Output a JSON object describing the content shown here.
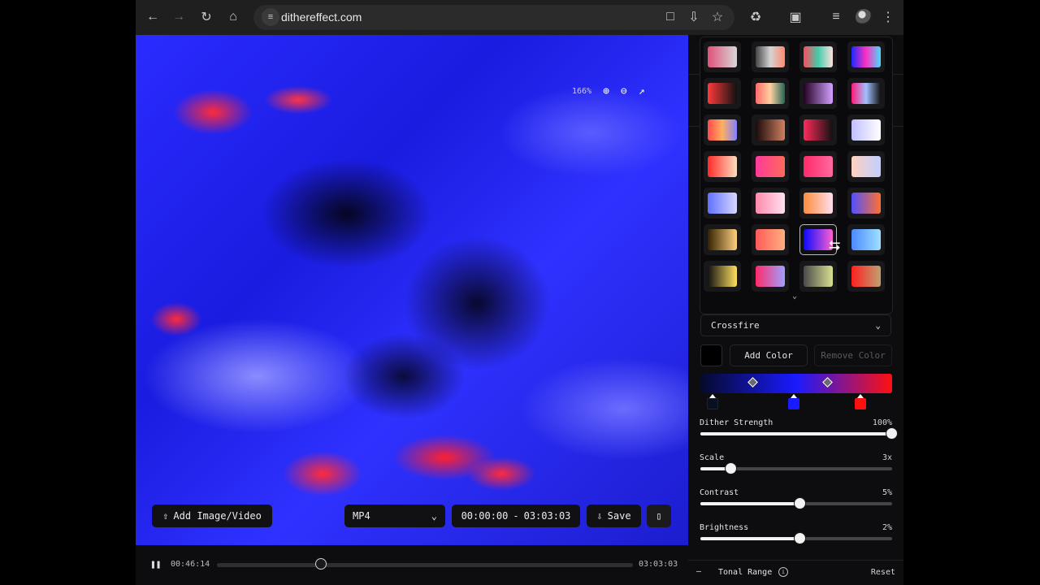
{
  "browser": {
    "url": "dithereffect.com",
    "icons": [
      "back-icon",
      "forward-icon",
      "reload-icon",
      "home-icon",
      "site-info-icon",
      "page-icon",
      "install-icon",
      "star-icon",
      "extensions-icon",
      "cast-icon",
      "reading-list-icon",
      "profile-avatar",
      "menu-icon"
    ]
  },
  "canvas": {
    "zoom": "166%",
    "zoom_in_icon": "zoom-in-icon",
    "zoom_out_icon": "zoom-out-icon",
    "fullscreen_icon": "fullscreen-icon"
  },
  "actions": {
    "add_media_label": "Add Image/Video",
    "format_value": "MP4",
    "time_start": "00:00:00",
    "time_sep": "-",
    "time_end": "03:03:03",
    "save_label": "Save"
  },
  "timeline": {
    "current": "00:46:14",
    "duration": "03:03:03",
    "progress": 0.25
  },
  "panel": {
    "palette_name": "Crossfire",
    "add_color_label": "Add Color",
    "remove_color_label": "Remove Color",
    "gradient_colors": [
      "#050a2a",
      "#1a1aff",
      "#ff1010"
    ],
    "presets": [
      [
        "#e0507a,#d8d8d8",
        "#444,#d4d4d4,#ff8a70",
        "#ff4a5a,#44ccaa,#ffe0e0",
        "#1a2aff,#ff30c0,#44ddff"
      ],
      [
        "#ff3a3a,#111",
        "#ff6a6a,#ffd0a0,#226655",
        "#220022,#d4a0ff",
        "#ff1a7a,#a0c0ff,#111"
      ],
      [
        "#ff4a4a,#ffb060,#8080ff",
        "#1a0a0a,#d08060",
        "#ff2a5a,#111",
        "#c0c0ff,#ffffff"
      ],
      [
        "#ff2a2a,#ffe0c0",
        "#ff3a9a,#ff6a5a",
        "#ff2a6a,#ff6aa0",
        "#ffd0c0,#c0d0ff"
      ],
      [
        "#6070ff,#d8d8ff",
        "#ff8aaa,#ffe0f0",
        "#ff8a3a,#ffe0f0",
        "#5050ff,#ff7030"
      ],
      [
        "#332200,#ffd080",
        "#ff5a5a,#ffb080",
        "#0a0aff,#ff60d0",
        "#4a8aff,#a0e0ff"
      ],
      [
        "#111,#ffe060",
        "#ff2a6a,#a0a0ff",
        "#4a4a4a,#d8e090",
        "#ff2020,#c0a070"
      ]
    ],
    "selected_preset": [
      5,
      2
    ],
    "sliders": [
      {
        "label": "Dither Strength",
        "value": "100%",
        "level": 1.0
      },
      {
        "label": "Scale",
        "value": "3x",
        "level": 0.16
      },
      {
        "label": "Contrast",
        "value": "5%",
        "level": 0.52
      },
      {
        "label": "Brightness",
        "value": "2%",
        "level": 0.52
      }
    ],
    "tonal_range_label": "Tonal Range",
    "reset_label": "Reset"
  }
}
